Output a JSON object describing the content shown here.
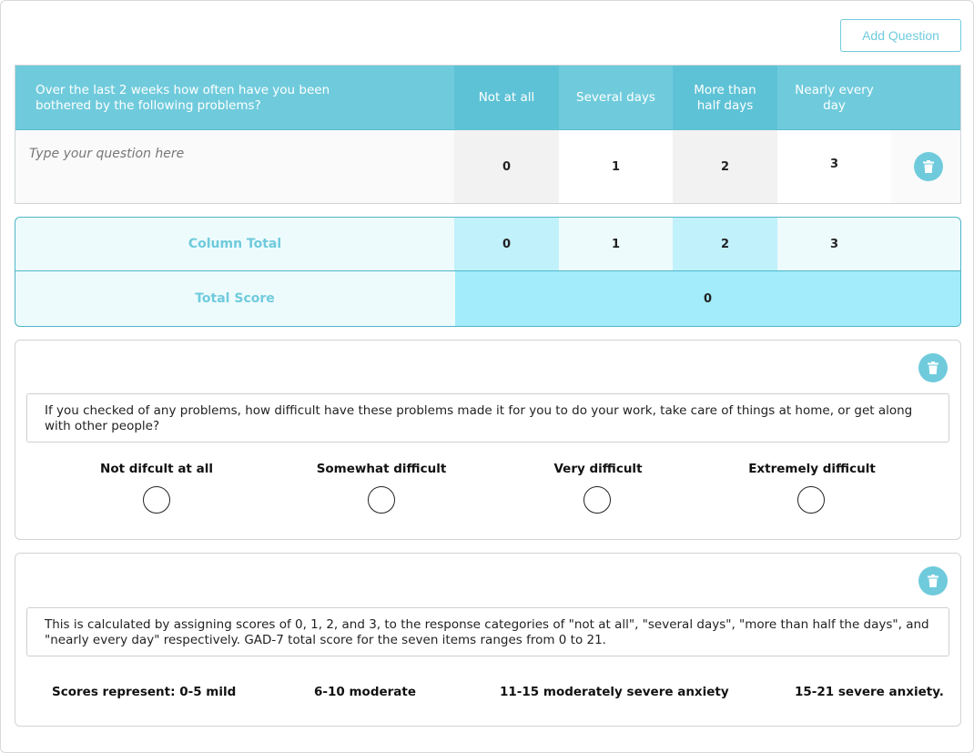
{
  "toolbar": {
    "add_question_label": "Add Question"
  },
  "grid": {
    "header_question": "Over the last 2 weeks how often have you been bothered by the following problems?",
    "columns": [
      {
        "label": "Not at all"
      },
      {
        "label": "Several days"
      },
      {
        "label": "More than half days"
      },
      {
        "label": "Nearly every day"
      }
    ],
    "row": {
      "placeholder": "Type your question here",
      "values": [
        "0",
        "1",
        "2",
        "3"
      ]
    }
  },
  "totals": {
    "column_total_label": "Column Total",
    "column_totals": [
      "0",
      "1",
      "2",
      "3"
    ],
    "total_score_label": "Total Score",
    "total_score": "0"
  },
  "difficulty": {
    "question": "If you checked of any problems, how difficult have these problems made it for you to do your work, take care of things at home, or get along with other people?",
    "options": [
      "Not difcult at all",
      "Somewhat difficult",
      "Very difficult",
      "Extremely difficult"
    ]
  },
  "scoring": {
    "text": "This is calculated by assigning scores of 0, 1, 2, and 3, to the response categories of \"not at all\", \"several days\", \"more than half the days\", and \"nearly every day\" respectively. GAD-7 total score for the seven items ranges from 0 to 21.",
    "ranges": [
      "Scores represent: 0-5 mild",
      "6-10 moderate",
      "11-15 moderately severe anxiety",
      "15-21 severe anxiety."
    ]
  },
  "icons": {
    "delete": "trash-icon"
  },
  "colors": {
    "accent": "#6fcbdc",
    "accent_dark": "#4fb6c8",
    "total_cell": "#a3ecfb"
  }
}
